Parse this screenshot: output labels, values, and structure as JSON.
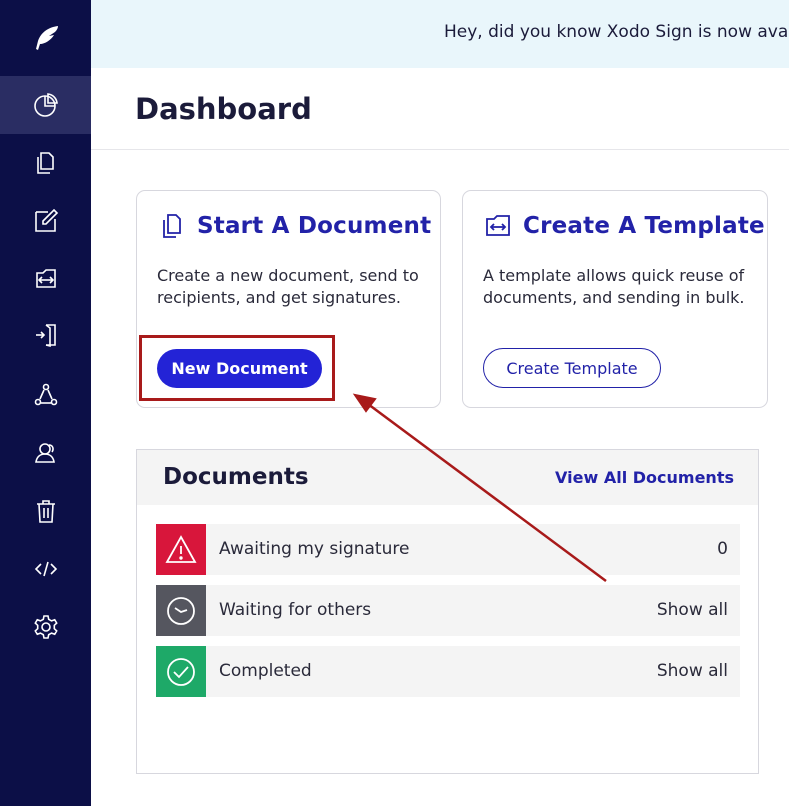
{
  "banner": {
    "text": "Hey, did you know Xodo Sign is now available"
  },
  "sidebar": {
    "logo_icon": "feather-icon",
    "items": [
      {
        "icon": "pie-chart-icon",
        "active": true
      },
      {
        "icon": "documents-icon",
        "active": false
      },
      {
        "icon": "edit-icon",
        "active": false
      },
      {
        "icon": "template-icon",
        "active": false
      },
      {
        "icon": "import-icon",
        "active": false
      },
      {
        "icon": "workflow-icon",
        "active": false
      },
      {
        "icon": "contacts-icon",
        "active": false
      },
      {
        "icon": "trash-icon",
        "active": false
      },
      {
        "icon": "code-icon",
        "active": false
      },
      {
        "icon": "gear-icon",
        "active": false
      }
    ]
  },
  "header": {
    "title": "Dashboard"
  },
  "cards": {
    "start": {
      "title": "Start A Document",
      "description": "Create a new document, send to recipients, and get signatures.",
      "button": "New Document"
    },
    "template": {
      "title": "Create A Template",
      "description": "A template allows quick reuse of documents, and sending in bulk.",
      "button": "Create Template"
    }
  },
  "documents": {
    "title": "Documents",
    "view_all": "View All Documents",
    "rows": [
      {
        "label": "Awaiting my signature",
        "value": "0",
        "status_color": "#d8163b",
        "icon": "warning-icon"
      },
      {
        "label": "Waiting for others",
        "value": "Show all",
        "status_color": "#55565f",
        "icon": "clock-icon"
      },
      {
        "label": "Completed",
        "value": "Show all",
        "status_color": "#1ea968",
        "icon": "check-circle-icon"
      }
    ]
  },
  "colors": {
    "sidebar_bg": "#0c0f47",
    "accent": "#2323d6",
    "annotation": "#a81a1a"
  }
}
